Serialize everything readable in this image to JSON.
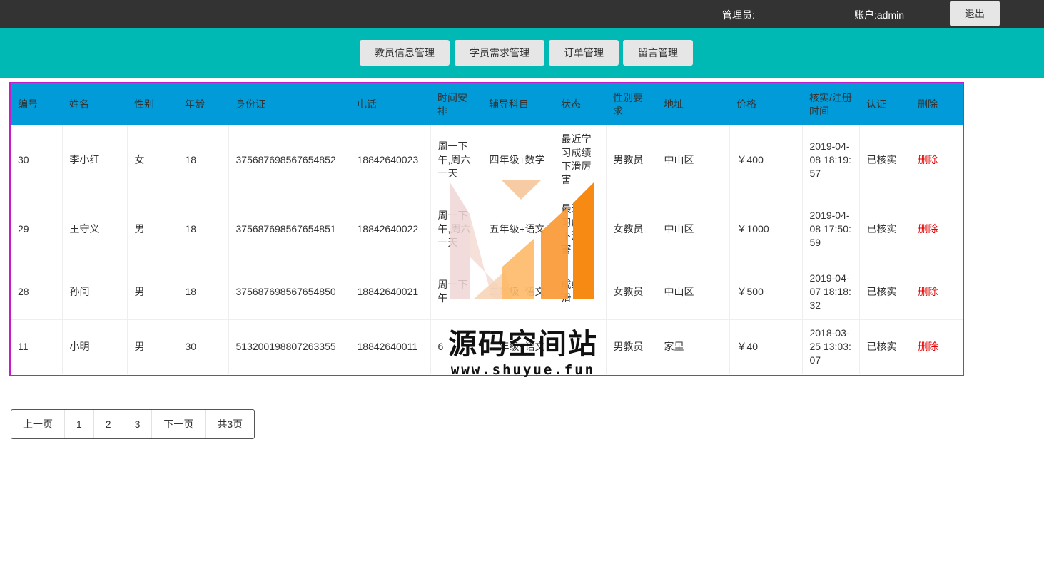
{
  "header": {
    "admin_label": "管理员:",
    "account_label": "账户:admin",
    "logout_label": "退出"
  },
  "nav": {
    "teacher": "教员信息管理",
    "student": "学员需求管理",
    "order": "订单管理",
    "message": "留言管理"
  },
  "table": {
    "columns": [
      "编号",
      "姓名",
      "性别",
      "年龄",
      "身份证",
      "电话",
      "时间安排",
      "辅导科目",
      "状态",
      "性别要求",
      "地址",
      "价格",
      "核实/注册时间",
      "认证",
      "删除"
    ],
    "rows": [
      [
        "30",
        "李小红",
        "女",
        "18",
        "375687698567654852",
        "18842640023",
        "周一下午,周六一天",
        "四年级+数学",
        "最近学习成绩下滑厉害",
        "男教员",
        "中山区",
        "￥400",
        "2019-04-08 18:19:57",
        "已核实",
        "删除"
      ],
      [
        "29",
        "王守义",
        "男",
        "18",
        "375687698567654851",
        "18842640022",
        "周一下午,周六一天",
        "五年级+语文",
        "最近学习成绩下滑厉害",
        "女教员",
        "中山区",
        "￥1000",
        "2019-04-08 17:50:59",
        "已核实",
        "删除"
      ],
      [
        "28",
        "孙问",
        "男",
        "18",
        "375687698567654850",
        "18842640021",
        "周一下午",
        "二年级+语文",
        "成绩下滑",
        "女教员",
        "中山区",
        "￥500",
        "2019-04-07 18:18:32",
        "已核实",
        "删除"
      ],
      [
        "11",
        "小明",
        "男",
        "30",
        "513200198807263355",
        "18842640011",
        "6",
        "三年级+语文",
        "",
        "男教员",
        "家里",
        "￥40",
        "2018-03-25 13:03:07",
        "已核实",
        "删除"
      ]
    ]
  },
  "pager": {
    "prev": "上一页",
    "pages": [
      "1",
      "2",
      "3"
    ],
    "next": "下一页",
    "total": "共3页"
  },
  "watermark": {
    "title": "源码空间站",
    "url": "www.shuyue.fun"
  },
  "colors": {
    "topbar": "#333333",
    "navbar": "#00b9b5",
    "table_header": "#009bd8",
    "table_border": "#c61bc9",
    "delete_link": "#e60000"
  }
}
